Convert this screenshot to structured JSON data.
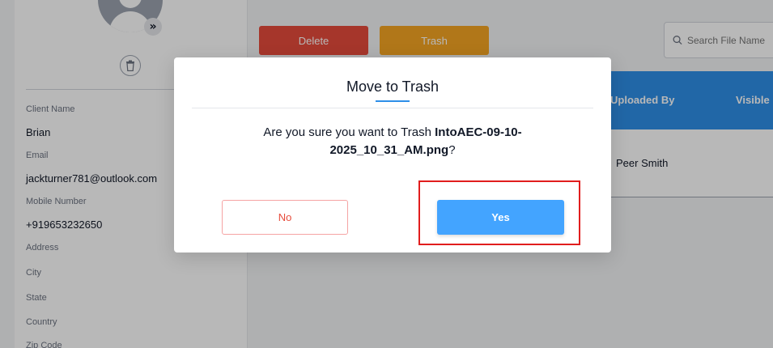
{
  "client": {
    "fields": [
      {
        "label": "Client Name",
        "value": "Brian"
      },
      {
        "label": "Email",
        "value": "jackturner781@outlook.com"
      },
      {
        "label": "Mobile Number",
        "value": "+919653232650"
      },
      {
        "label": "Address",
        "value": ""
      },
      {
        "label": "City",
        "value": ""
      },
      {
        "label": "State",
        "value": ""
      },
      {
        "label": "Country",
        "value": ""
      },
      {
        "label": "Zip Code",
        "value": ""
      }
    ]
  },
  "toolbar": {
    "delete_label": "Delete",
    "trash_label": "Trash",
    "search_placeholder": "Search File Name"
  },
  "table": {
    "headers": [
      "Uploaded By",
      "Visible"
    ],
    "rows": [
      {
        "uploaded_by": "Peer Smith"
      }
    ]
  },
  "modal": {
    "title": "Move to Trash",
    "message_prefix": "Are you sure you want to Trash ",
    "filename": "IntoAEC-09-10-2025_10_31_AM.png",
    "message_suffix": "?",
    "no_label": "No",
    "yes_label": "Yes"
  },
  "colors": {
    "accent": "#2e8fe8",
    "yes_button": "#43a4ff",
    "delete": "#e74c3c",
    "trash": "#f5a623",
    "highlight": "#e11d1d"
  },
  "icons": {
    "avatar": "user-avatar-icon",
    "expand": "double-chevron-right-icon",
    "trash": "trash-icon",
    "search": "search-icon"
  }
}
